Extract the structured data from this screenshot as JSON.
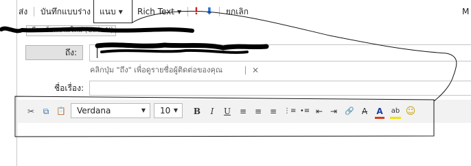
{
  "toolbar": {
    "send_label": "ส่ง",
    "save_draft_label": "บันทึกแบบร่าง",
    "insert_label": "แนบ",
    "format_mode_label": "Rich Text",
    "cancel_label": "ยกเลิก",
    "overflow_label": "M"
  },
  "tooltip": {
    "text": "เขียนข้อความใหม่ (Ctrl+N)"
  },
  "to": {
    "button_label": "ถึง:",
    "value": "",
    "hint": "คลิกปุ่ม \"ถึง\" เพื่อดูรายชื่อผู้ติดต่อของคุณ"
  },
  "subject": {
    "label": "ชื่อเรื่อง:",
    "value": ""
  },
  "format_toolbar": {
    "font_family": "Verdana",
    "font_size": "10"
  },
  "icons": {
    "close": "✕",
    "flag": "!",
    "arrow": "⬇",
    "cut": "✂",
    "copy": "⧉",
    "paste": "📋",
    "bold": "B",
    "italic": "I",
    "underline": "U",
    "align_left": "≡",
    "align_center": "≡",
    "align_right": "≡",
    "numbered_list": "⋮≡",
    "bullet_list": "•≡",
    "outdent": "⇤",
    "indent": "⇥",
    "link": "🔗",
    "strike": "A̶",
    "font_color": "A",
    "highlight": "ab",
    "emoji": "☺"
  },
  "colors": {
    "font_color_bar": "#d43a1a",
    "highlight_bar": "#f2e200",
    "priority_red": "#d42020",
    "arrow_blue": "#2a6fd6"
  }
}
